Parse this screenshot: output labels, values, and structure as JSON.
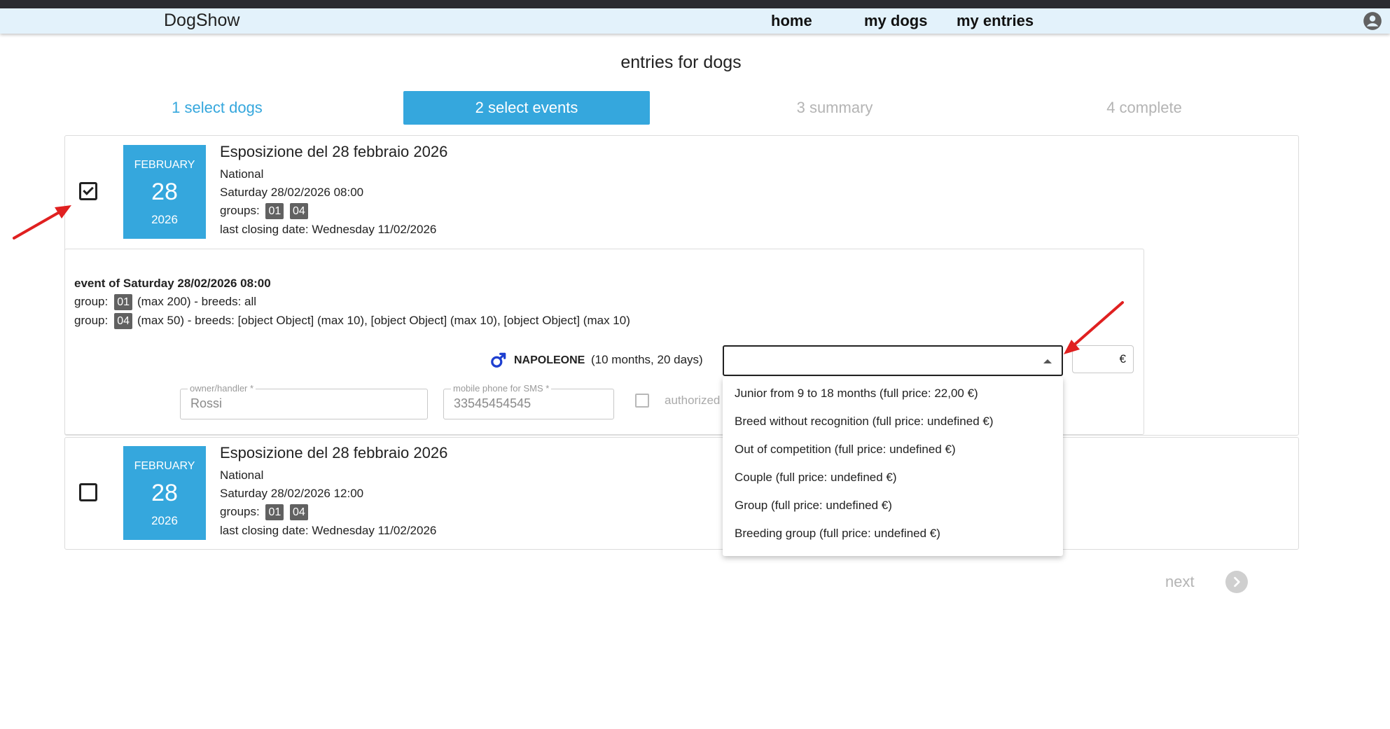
{
  "appbar": {
    "brand": "DogShow",
    "nav": [
      "home",
      "my dogs",
      "my entries"
    ],
    "account_icon": "account-circle-icon"
  },
  "page": {
    "title": "entries for dogs"
  },
  "steps": [
    {
      "label": "1 select dogs",
      "state": "done"
    },
    {
      "label": "2 select events",
      "state": "active"
    },
    {
      "label": "3 summary",
      "state": "todo"
    },
    {
      "label": "4 complete",
      "state": "todo"
    }
  ],
  "events": [
    {
      "checked": true,
      "month": "FEBRUARY",
      "day": "28",
      "year": "2026",
      "title": "Esposizione del 28 febbraio 2026",
      "type": "National",
      "datetime": "Saturday 28/02/2026 08:00",
      "groups_label": "groups:",
      "groups": [
        "01",
        "04"
      ],
      "closing": "last closing date: Wednesday 11/02/2026"
    },
    {
      "checked": false,
      "month": "FEBRUARY",
      "day": "28",
      "year": "2026",
      "title": "Esposizione del 28 febbraio 2026",
      "type": "National",
      "datetime": "Saturday 28/02/2026 12:00",
      "groups_label": "groups:",
      "groups": [
        "01",
        "04"
      ],
      "closing": "last closing date: Wednesday 11/02/2026"
    }
  ],
  "detail": {
    "heading": "event of Saturday 28/02/2026 08:00",
    "group_label": "group:",
    "group1": {
      "code": "01",
      "text": "(max 200) - breeds: all"
    },
    "group2": {
      "code": "04",
      "text": "(max 50) - breeds: [object Object] (max 10), [object Object] (max 10), [object Object] (max 10)"
    },
    "dog": {
      "icon": "male-icon",
      "name": "NAPOLEONE",
      "age": "(10 months, 20 days)"
    },
    "class_select": {
      "value": ""
    },
    "price": {
      "value": "",
      "currency": "€"
    },
    "owner": {
      "label": "owner/handler *",
      "value": "Rossi"
    },
    "phone": {
      "label": "mobile phone for SMS *",
      "value": "33545454545"
    },
    "authorized": {
      "label": "authorized",
      "checked": false
    },
    "options": [
      "Junior from 9 to 18 months (full price: 22,00 €)",
      "Breed without recognition (full price: undefined €)",
      "Out of competition (full price: undefined €)",
      "Couple (full price: undefined €)",
      "Group (full price: undefined €)",
      "Breeding group (full price: undefined €)"
    ]
  },
  "footer": {
    "next_label": "next",
    "next_icon": "chevron-right-icon"
  },
  "colors": {
    "primary": "#35a7dd",
    "appbar": "#e3f2fb",
    "chip": "#616161",
    "annotation": "#e02020"
  }
}
